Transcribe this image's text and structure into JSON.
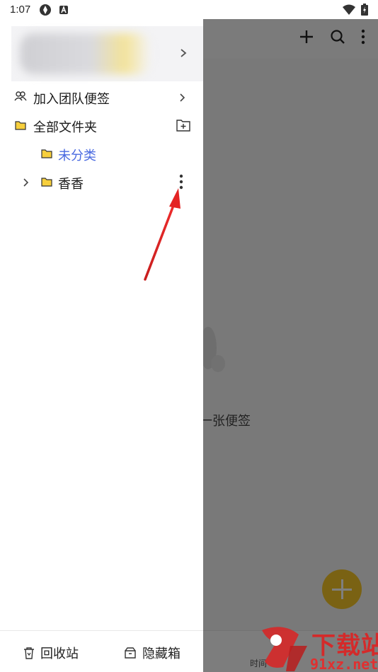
{
  "status_bar": {
    "time": "1:07"
  },
  "background_app": {
    "empty_text": "一张便签",
    "bottom_label": "时间",
    "fab_color": "#f5c527"
  },
  "drawer": {
    "menu": {
      "team_notes": "加入团队便签",
      "all_folders": "全部文件夹"
    },
    "folders": {
      "uncategorized": "未分类",
      "xiangxiang": "香香"
    },
    "bottom": {
      "recycle_bin": "回收站",
      "hidden_box": "隐藏箱"
    },
    "accent_color": "#4a6ae0",
    "folder_color": "#f7cf3c"
  },
  "watermark": {
    "title": "下载站",
    "subtitle": "91xz.net",
    "color": "#d42a2a"
  }
}
